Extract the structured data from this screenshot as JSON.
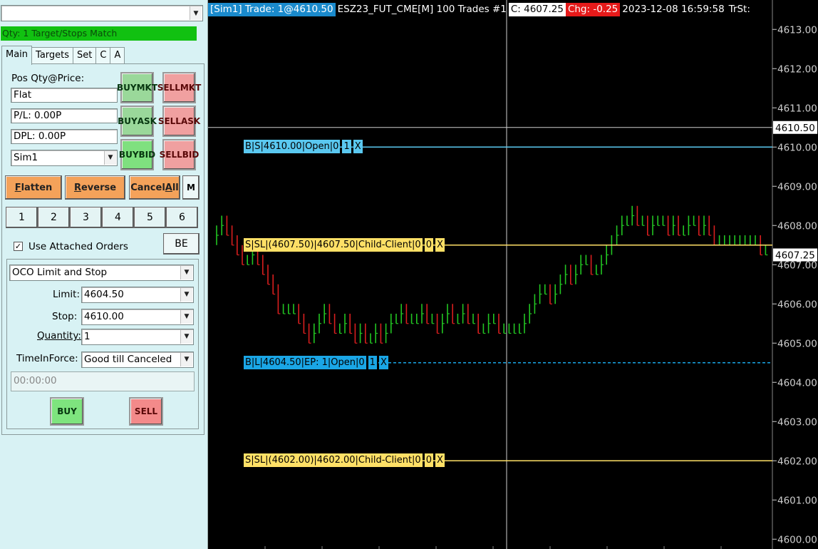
{
  "left": {
    "status": "Qty: 1 Target/Stops Match",
    "tabs": [
      "Main",
      "Targets",
      "Set",
      "C",
      "A"
    ],
    "pos_label": "Pos Qty@Price:",
    "pos_value": "Flat",
    "pl_value": "P/L: 0.00P",
    "dpl_value": "DPL: 0.00P",
    "account": "Sim1",
    "buy_mkt": [
      "BUY",
      "MKT"
    ],
    "sell_mkt": [
      "SELL",
      "MKT"
    ],
    "buy_ask": [
      "BUY",
      "ASK"
    ],
    "sell_ask": [
      "SELL",
      "ASK"
    ],
    "buy_bid": [
      "BUY",
      "BID"
    ],
    "sell_bid": [
      "SELL",
      "BID"
    ],
    "flatten_rest": "latten",
    "flatten_u": "F",
    "reverse_rest": "everse",
    "reverse_u": "R",
    "cancel_pre": "Cancel",
    "cancel_u": "A",
    "cancel_rest": "ll",
    "m_label": "M",
    "qty_buttons": [
      "1",
      "2",
      "3",
      "4",
      "5",
      "6"
    ],
    "use_attached": "Use Attached Orders",
    "be_label": "BE",
    "order_type": "OCO Limit and Stop",
    "limit_label": "Limit:",
    "limit_value": "4604.50",
    "stop_label": "Stop:",
    "stop_value": "4610.00",
    "quantity_label": "Quantity:",
    "quantity_value": "1",
    "tif_label": "TimeInForce:",
    "tif_value": "Good till Canceled",
    "time_value": "00:00:00",
    "buy_label": "BUY",
    "sell_label": "SELL"
  },
  "chart_header": {
    "trade": "[Sim1] Trade: 1@4610.50",
    "symbol": "ESZ23_FUT_CME[M]  100 Trades #1",
    "close": "C: 4607.25",
    "change": "Chg: -0.25",
    "datetime": "2023-12-08  16:59:58",
    "trst": "TrSt:"
  },
  "orders": [
    {
      "text": "B|S|4610.00|Open|0",
      "qty": "1",
      "x": "X",
      "price": 4610.0,
      "color": "#5ac8f0",
      "style": "solid"
    },
    {
      "text": "S|SL|(4607.50)|4607.50|Child-Client|0",
      "qty": "0",
      "x": "X",
      "price": 4607.5,
      "color": "#ffe066",
      "style": "solid"
    },
    {
      "text": "B|L|4604.50|EP: 1|Open|0",
      "qty": "1",
      "x": "X",
      "price": 4604.5,
      "color": "#1aa6e6",
      "style": "dashed"
    },
    {
      "text": "S|SL|(4602.00)|4602.00|Child-Client|0",
      "qty": "0",
      "x": "X",
      "price": 4602.0,
      "color": "#ffe066",
      "style": "solid"
    }
  ],
  "price_marks": {
    "last_trade": "4610.50",
    "close": "4607.25"
  },
  "chart_data": {
    "type": "bar",
    "ylim": [
      4599.75,
      4613.75
    ],
    "y_ticks": [
      "4613.00",
      "4612.00",
      "4611.00",
      "4610.00",
      "4609.00",
      "4608.00",
      "4607.00",
      "4606.00",
      "4605.00",
      "4604.00",
      "4603.00",
      "4602.00",
      "4601.00",
      "4600.00"
    ],
    "colors": {
      "up": "#22c522",
      "down": "#d81e1e",
      "axis": "#cfcfcf"
    },
    "bars_close": [
      4607.75,
      4608.0,
      4607.75,
      4607.5,
      4607.25,
      4607.0,
      4607.0,
      4607.25,
      4607.0,
      4606.75,
      4606.5,
      4606.25,
      4605.75,
      4605.75,
      4605.75,
      4605.75,
      4605.5,
      4605.25,
      4605.0,
      4605.25,
      4605.5,
      4605.75,
      4605.5,
      4605.25,
      4605.25,
      4605.5,
      4605.25,
      4605.0,
      4605.25,
      4605.0,
      4605.0,
      4605.25,
      4605.0,
      4605.25,
      4605.5,
      4605.5,
      4605.75,
      4605.5,
      4605.5,
      4605.5,
      4605.75,
      4605.5,
      4605.5,
      4605.25,
      4605.5,
      4605.75,
      4605.5,
      4605.5,
      4605.75,
      4605.5,
      4605.5,
      4605.25,
      4605.25,
      4605.5,
      4605.5,
      4605.25,
      4605.25,
      4605.25,
      4605.25,
      4605.25,
      4605.5,
      4605.75,
      4606.0,
      4606.25,
      4606.25,
      4606.0,
      4606.25,
      4606.5,
      4606.75,
      4606.5,
      4606.75,
      4607.0,
      4607.0,
      4606.75,
      4606.75,
      4607.0,
      4607.25,
      4607.5,
      4607.75,
      4608.0,
      4608.0,
      4608.25,
      4608.0,
      4608.0,
      4607.75,
      4608.0,
      4608.0,
      4608.0,
      4607.75,
      4608.0,
      4607.75,
      4607.75,
      4608.0,
      4608.0,
      4607.75,
      4608.0,
      4607.75,
      4607.5,
      4607.5,
      4607.5,
      4607.5,
      4607.5,
      4607.5,
      4607.5,
      4607.5,
      4607.5,
      4607.25,
      4607.25
    ]
  }
}
